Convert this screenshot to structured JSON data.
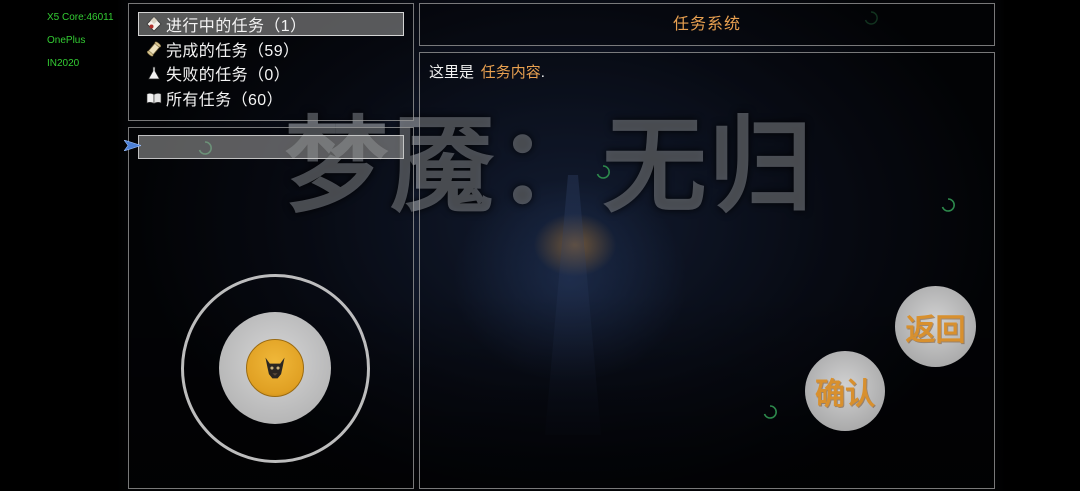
{
  "debug_overlay": {
    "core": "X5 Core:46011",
    "device": "OnePlus",
    "model": "IN2020"
  },
  "background": {
    "logo_text": "梦魇：无归"
  },
  "task_categories": {
    "selected_index": 0,
    "items": [
      {
        "label": "进行中的任务（1）",
        "icon": "task-tag-icon"
      },
      {
        "label": "完成的任务（59）",
        "icon": "scroll-icon"
      },
      {
        "label": "失败的任务（0）",
        "icon": "flask-icon"
      },
      {
        "label": "所有任务（60）",
        "icon": "book-icon"
      }
    ]
  },
  "task_list": {
    "cursor_icon": "arrow-cursor-icon"
  },
  "joystick": {
    "knob_icon": "demon-mask-icon"
  },
  "task_panel": {
    "title": "任务系统",
    "content_prefix": "这里是",
    "content_highlight": "任务内容",
    "content_suffix": "."
  },
  "buttons": {
    "back_label": "返回",
    "confirm_label": "确认"
  },
  "colors": {
    "accent": "#e8a050",
    "button_text": "#d8902e",
    "debug_text": "#33cc33",
    "cursor": "#4b7fd6",
    "knob": "#e0a023"
  }
}
